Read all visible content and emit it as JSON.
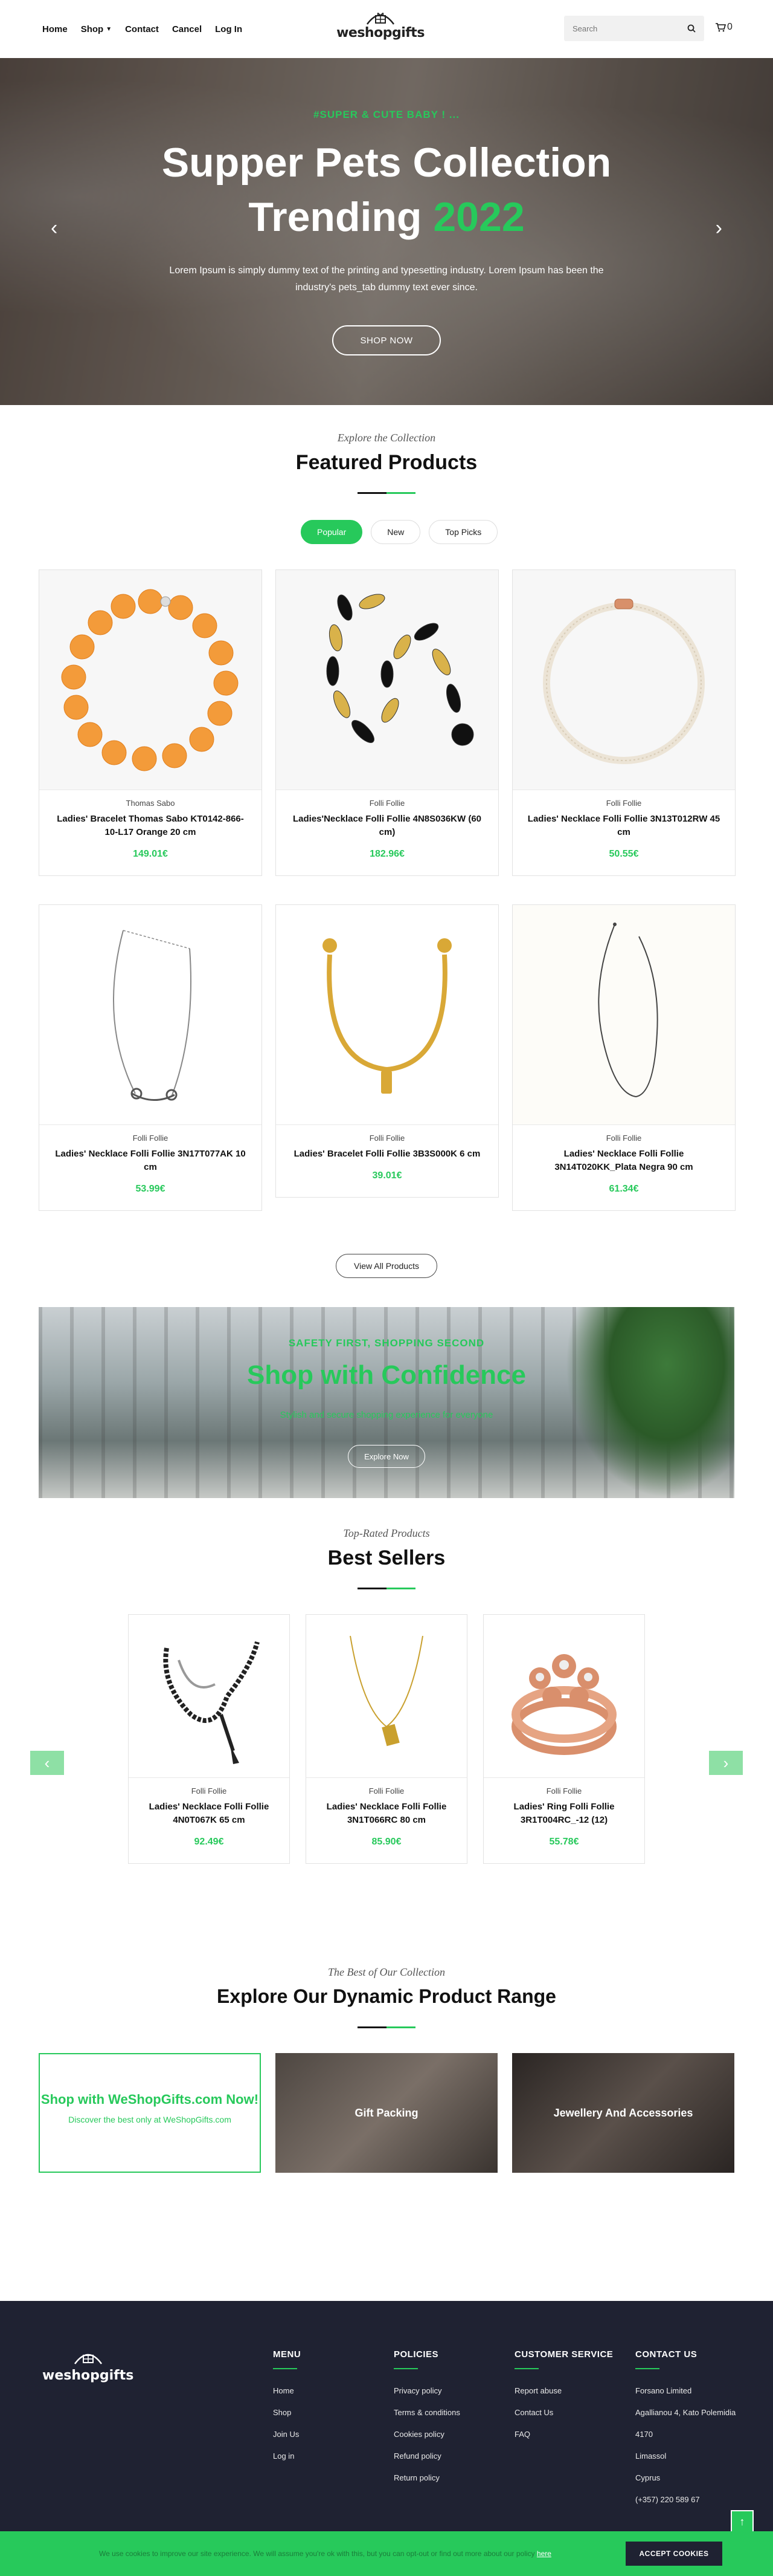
{
  "header": {
    "nav": [
      "Home",
      "Shop",
      "Contact",
      "Cancel",
      "Log In"
    ],
    "logo": "weshopgifts",
    "search_placeholder": "Search",
    "cart_count": "0"
  },
  "hero": {
    "tag": "#SUPER & CUTE BABY ! ...",
    "title_line1": "Supper Pets Collection",
    "title_line2": "Trending",
    "title_accent": "2022",
    "description": "Lorem Ipsum is simply dummy text of the printing and typesetting industry. Lorem Ipsum has been the industry's pets_tab dummy text ever since.",
    "button": "SHOP NOW"
  },
  "featured": {
    "subtitle": "Explore the Collection",
    "title": "Featured Products",
    "tabs": [
      "Popular",
      "New",
      "Top Picks"
    ],
    "products": [
      {
        "brand": "Thomas Sabo",
        "name": "Ladies' Bracelet Thomas Sabo KT0142-866-10-L17 Orange 20 cm",
        "price": "149.01€"
      },
      {
        "brand": "Folli Follie",
        "name": "Ladies'Necklace Folli Follie 4N8S036KW (60 cm)",
        "price": "182.96€"
      },
      {
        "brand": "Folli Follie",
        "name": "Ladies' Necklace Folli Follie 3N13T012RW 45 cm",
        "price": "50.55€"
      },
      {
        "brand": "Folli Follie",
        "name": "Ladies' Necklace Folli Follie 3N17T077AK 10 cm",
        "price": "53.99€"
      },
      {
        "brand": "Folli Follie",
        "name": "Ladies' Bracelet Folli Follie 3B3S000K 6 cm",
        "price": "39.01€"
      },
      {
        "brand": "Folli Follie",
        "name": "Ladies' Necklace Folli Follie 3N14T020KK_Plata Negra 90 cm",
        "price": "61.34€"
      }
    ],
    "view_all": "View All Products"
  },
  "banner": {
    "tag": "SAFETY FIRST, SHOPPING SECOND",
    "title": "Shop with Confidence",
    "description": "Stylish and secure shopping experience for everyone",
    "button": "Explore Now"
  },
  "bestsellers": {
    "subtitle": "Top-Rated Products",
    "title": "Best Sellers",
    "products": [
      {
        "brand": "Folli Follie",
        "name": "Ladies' Necklace Folli Follie 4N0T067K 65 cm",
        "price": "92.49€"
      },
      {
        "brand": "Folli Follie",
        "name": "Ladies' Necklace Folli Follie 3N1T066RC 80 cm",
        "price": "85.90€"
      },
      {
        "brand": "Folli Follie",
        "name": "Ladies' Ring Folli Follie 3R1T004RC_-12 (12)",
        "price": "55.78€"
      }
    ]
  },
  "range": {
    "subtitle": "The Best of Our Collection",
    "title": "Explore Our Dynamic Product Range",
    "promo_title": "Shop with WeShopGifts.com Now!",
    "promo_sub": "Discover the best only at WeShopGifts.com",
    "categories": [
      "Gift Packing",
      "Jewellery And Accessories"
    ]
  },
  "footer": {
    "logo": "weshopgifts",
    "menu": {
      "title": "MENU",
      "items": [
        "Home",
        "Shop",
        "Join Us",
        "Log in"
      ]
    },
    "policies": {
      "title": "POLICIES",
      "items": [
        "Privacy policy",
        "Terms & conditions",
        "Cookies policy",
        "Refund policy",
        "Return policy"
      ]
    },
    "service": {
      "title": "CUSTOMER SERVICE",
      "items": [
        "Report abuse",
        "Contact Us",
        "FAQ"
      ]
    },
    "contact": {
      "title": "CONTACT US",
      "items": [
        "Forsano Limited",
        "Agallianou 4, Kato Polemidia",
        "4170",
        "Limassol",
        "Cyprus",
        "(+357) 220 589 67"
      ]
    }
  },
  "cookie": {
    "text": "We use cookies to improve our site experience. We will assume you're ok with this, but you can opt-out or find out more about our policy",
    "link": "here",
    "button": "ACCEPT COOKIES"
  },
  "colors": {
    "accent": "#27c95b",
    "footer_bg": "#1f2232"
  }
}
